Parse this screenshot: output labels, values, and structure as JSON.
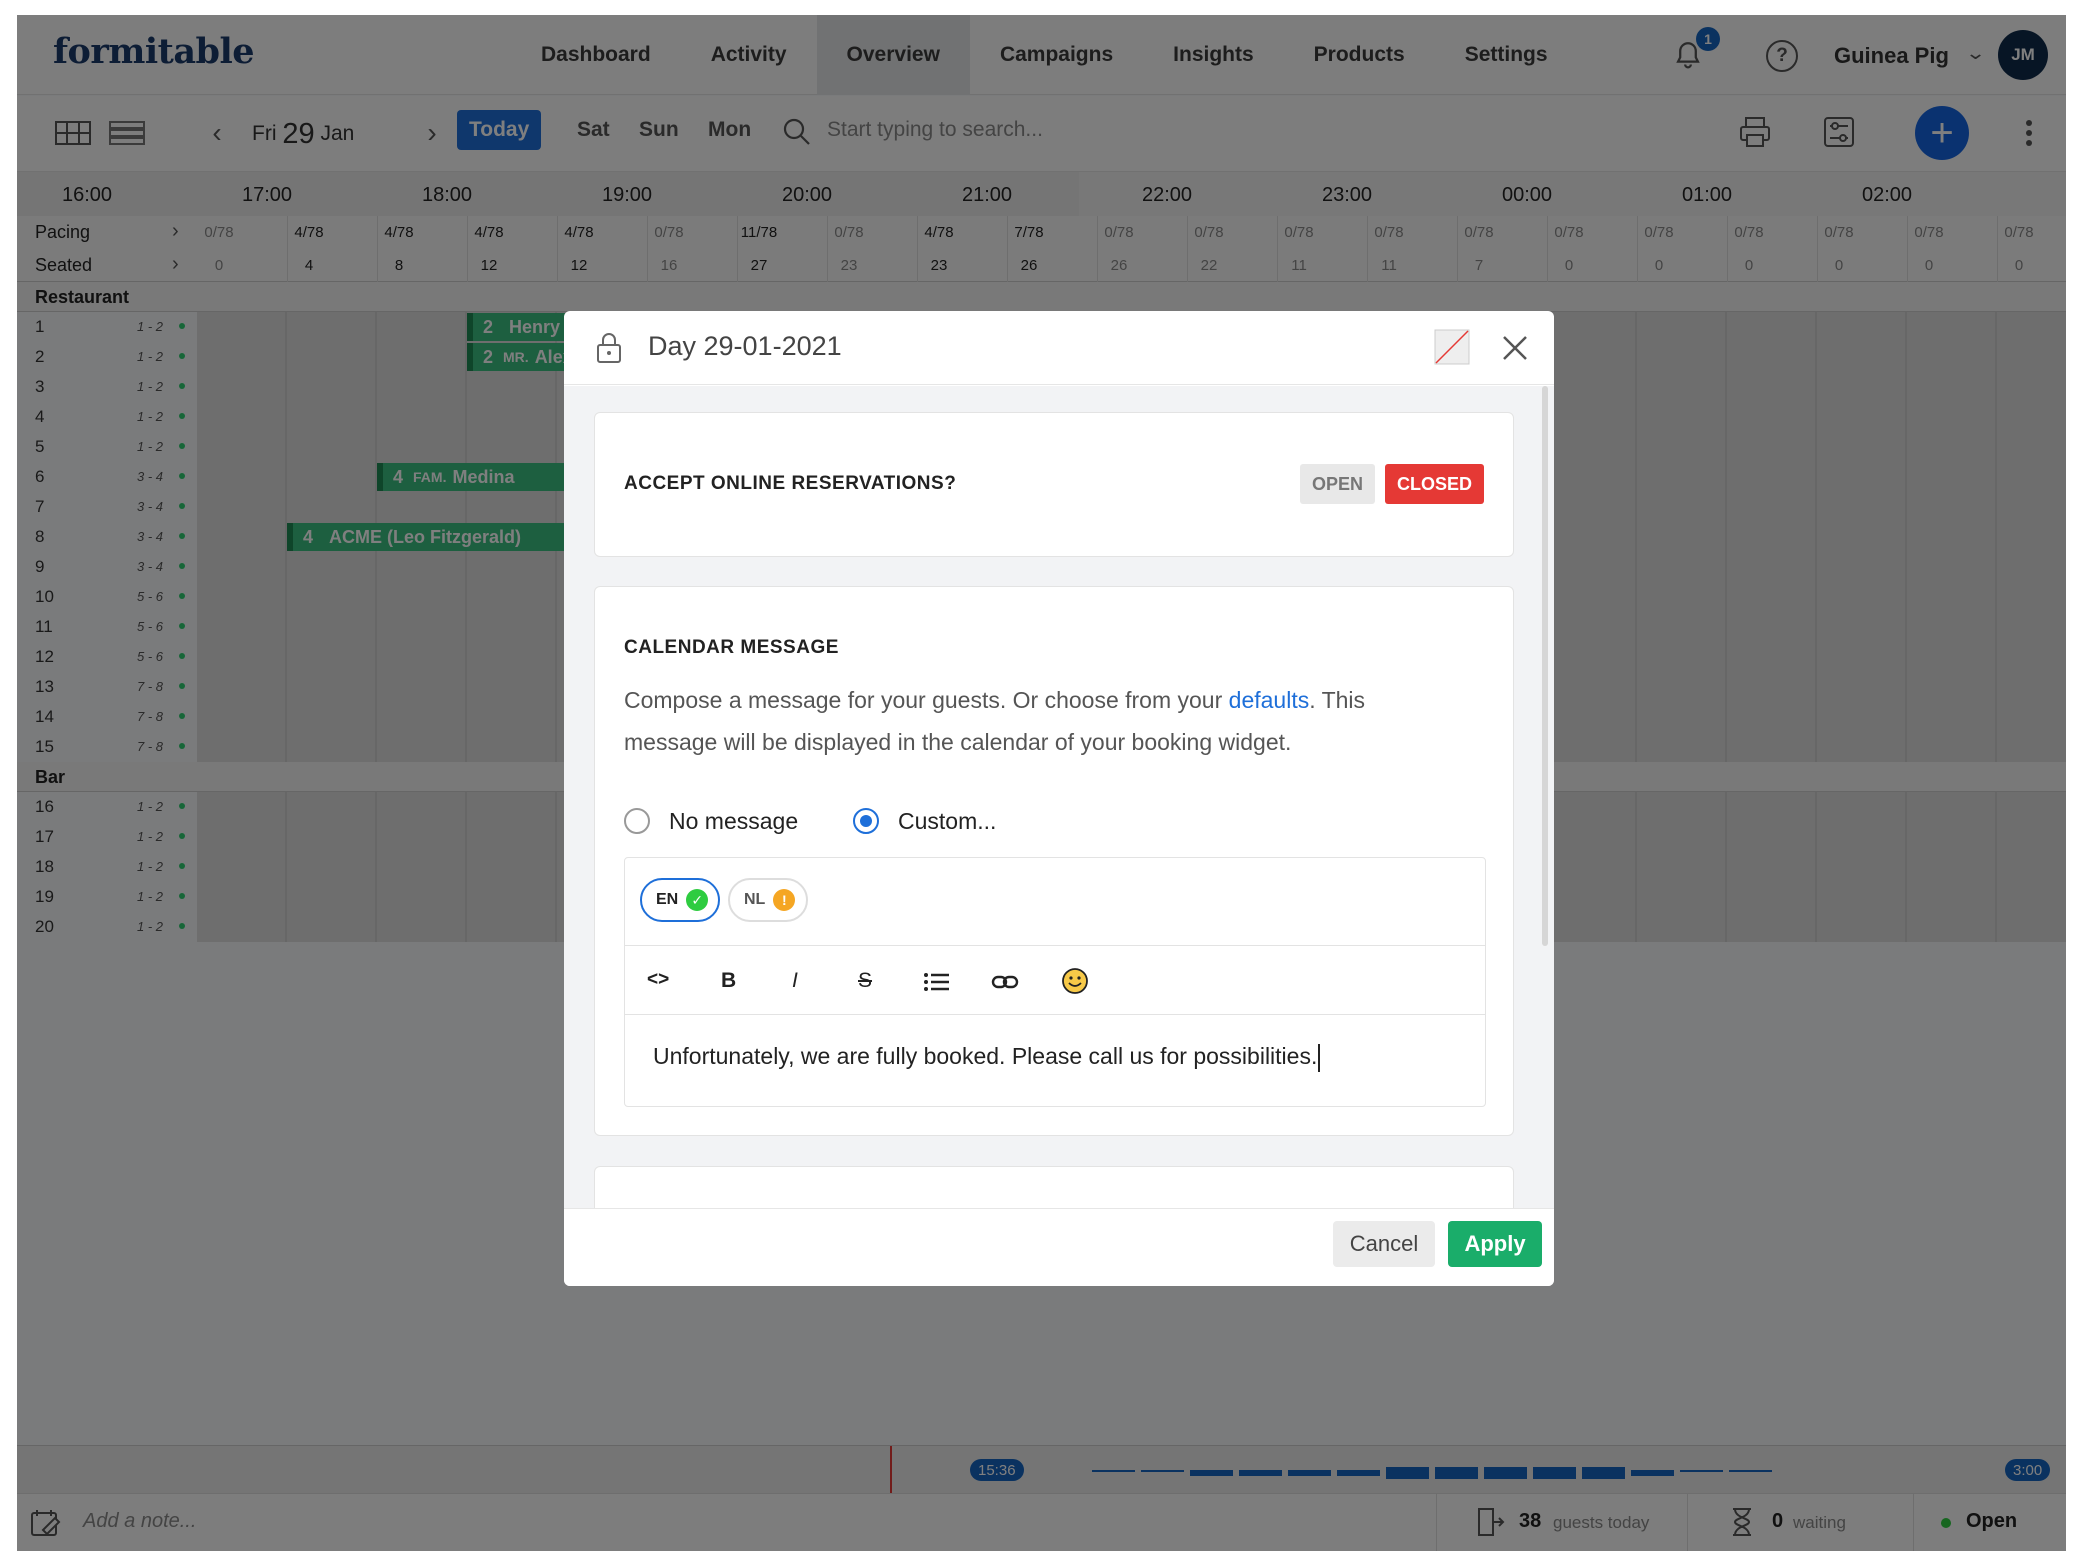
{
  "header": {
    "logo": "formitable",
    "nav": [
      "Dashboard",
      "Activity",
      "Overview",
      "Campaigns",
      "Insights",
      "Products",
      "Settings"
    ],
    "active_nav": "Overview",
    "notification_count": "1",
    "help": "?",
    "user_name": "Guinea Pig",
    "avatar_initials": "JM"
  },
  "toolbar": {
    "date_dow": "Fri",
    "date_day": "29",
    "date_month": "Jan",
    "today": "Today",
    "days": [
      "Sat",
      "Sun",
      "Mon"
    ],
    "search_placeholder": "Start typing to search..."
  },
  "timeline": {
    "times": [
      "16:00",
      "17:00",
      "18:00",
      "19:00",
      "20:00",
      "21:00",
      "22:00",
      "23:00",
      "00:00",
      "01:00",
      "02:00"
    ],
    "pacing_label": "Pacing",
    "seated_label": "Seated",
    "pacing": [
      "0/78",
      "4/78",
      "4/78",
      "4/78",
      "4/78",
      "0/78",
      "11/78",
      "0/78",
      "4/78",
      "7/78",
      "0/78",
      "0/78",
      "0/78",
      "0/78",
      "0/78",
      "0/78",
      "0/78",
      "0/78",
      "0/78",
      "0/78",
      "0/78"
    ],
    "seated": [
      "0",
      "4",
      "8",
      "12",
      "12",
      "16",
      "27",
      "23",
      "23",
      "26",
      "26",
      "22",
      "11",
      "11",
      "7",
      "0",
      "0",
      "0",
      "0",
      "0",
      "0"
    ]
  },
  "sections": [
    {
      "name": "Restaurant",
      "rows": [
        {
          "num": "1",
          "cap": "1 - 2"
        },
        {
          "num": "2",
          "cap": "1 - 2"
        },
        {
          "num": "3",
          "cap": "1 - 2"
        },
        {
          "num": "4",
          "cap": "1 - 2"
        },
        {
          "num": "5",
          "cap": "1 - 2"
        },
        {
          "num": "6",
          "cap": "3 - 4"
        },
        {
          "num": "7",
          "cap": "3 - 4"
        },
        {
          "num": "8",
          "cap": "3 - 4"
        },
        {
          "num": "9",
          "cap": "3 - 4"
        },
        {
          "num": "10",
          "cap": "5 - 6"
        },
        {
          "num": "11",
          "cap": "5 - 6"
        },
        {
          "num": "12",
          "cap": "5 - 6"
        },
        {
          "num": "13",
          "cap": "7 - 8"
        },
        {
          "num": "14",
          "cap": "7 - 8"
        },
        {
          "num": "15",
          "cap": "7 - 8"
        }
      ]
    },
    {
      "name": "Bar",
      "rows": [
        {
          "num": "16",
          "cap": "1 - 2"
        },
        {
          "num": "17",
          "cap": "1 - 2"
        },
        {
          "num": "18",
          "cap": "1 - 2"
        },
        {
          "num": "19",
          "cap": "1 - 2"
        },
        {
          "num": "20",
          "cap": "1 - 2"
        }
      ]
    }
  ],
  "bookings": [
    {
      "size": "2",
      "prefix": "",
      "name": "Henry",
      "table": "1"
    },
    {
      "size": "2",
      "prefix": "MR.",
      "name": "Alex",
      "table": "2"
    },
    {
      "size": "4",
      "prefix": "FAM.",
      "name": "Medina",
      "table": "6"
    },
    {
      "size": "4",
      "prefix": "",
      "name": "ACME (Leo Fitzgerald)",
      "table": "8"
    }
  ],
  "footer": {
    "now_time": "15:36",
    "end_time": "3:00",
    "note_placeholder": "Add a note...",
    "guests_count": "38",
    "guests_label": "guests today",
    "waiting_count": "0",
    "waiting_label": "waiting",
    "status": "Open"
  },
  "modal": {
    "title": "Day 29-01-2021",
    "accept_card": {
      "title": "ACCEPT ONLINE RESERVATIONS?",
      "open_label": "OPEN",
      "closed_label": "CLOSED",
      "selected": "CLOSED"
    },
    "message_card": {
      "title": "CALENDAR MESSAGE",
      "desc_before": "Compose a message for your guests. Or choose from your ",
      "desc_link": "defaults",
      "desc_after": ". This message will be displayed in the calendar of your booking widget.",
      "radio_none": "No message",
      "radio_custom": "Custom...",
      "selected": "Custom...",
      "lang_en": "EN",
      "lang_nl": "NL",
      "editor_text": "Unfortunately, we are fully booked. Please call us for possibilities."
    },
    "cancel": "Cancel",
    "apply": "Apply"
  },
  "colors": {
    "brand": "#1b3a6b",
    "primary": "#1e6fd9",
    "success": "#1aad6a",
    "danger": "#e53935",
    "warning": "#f5a623",
    "booking": "#3bbf80"
  }
}
